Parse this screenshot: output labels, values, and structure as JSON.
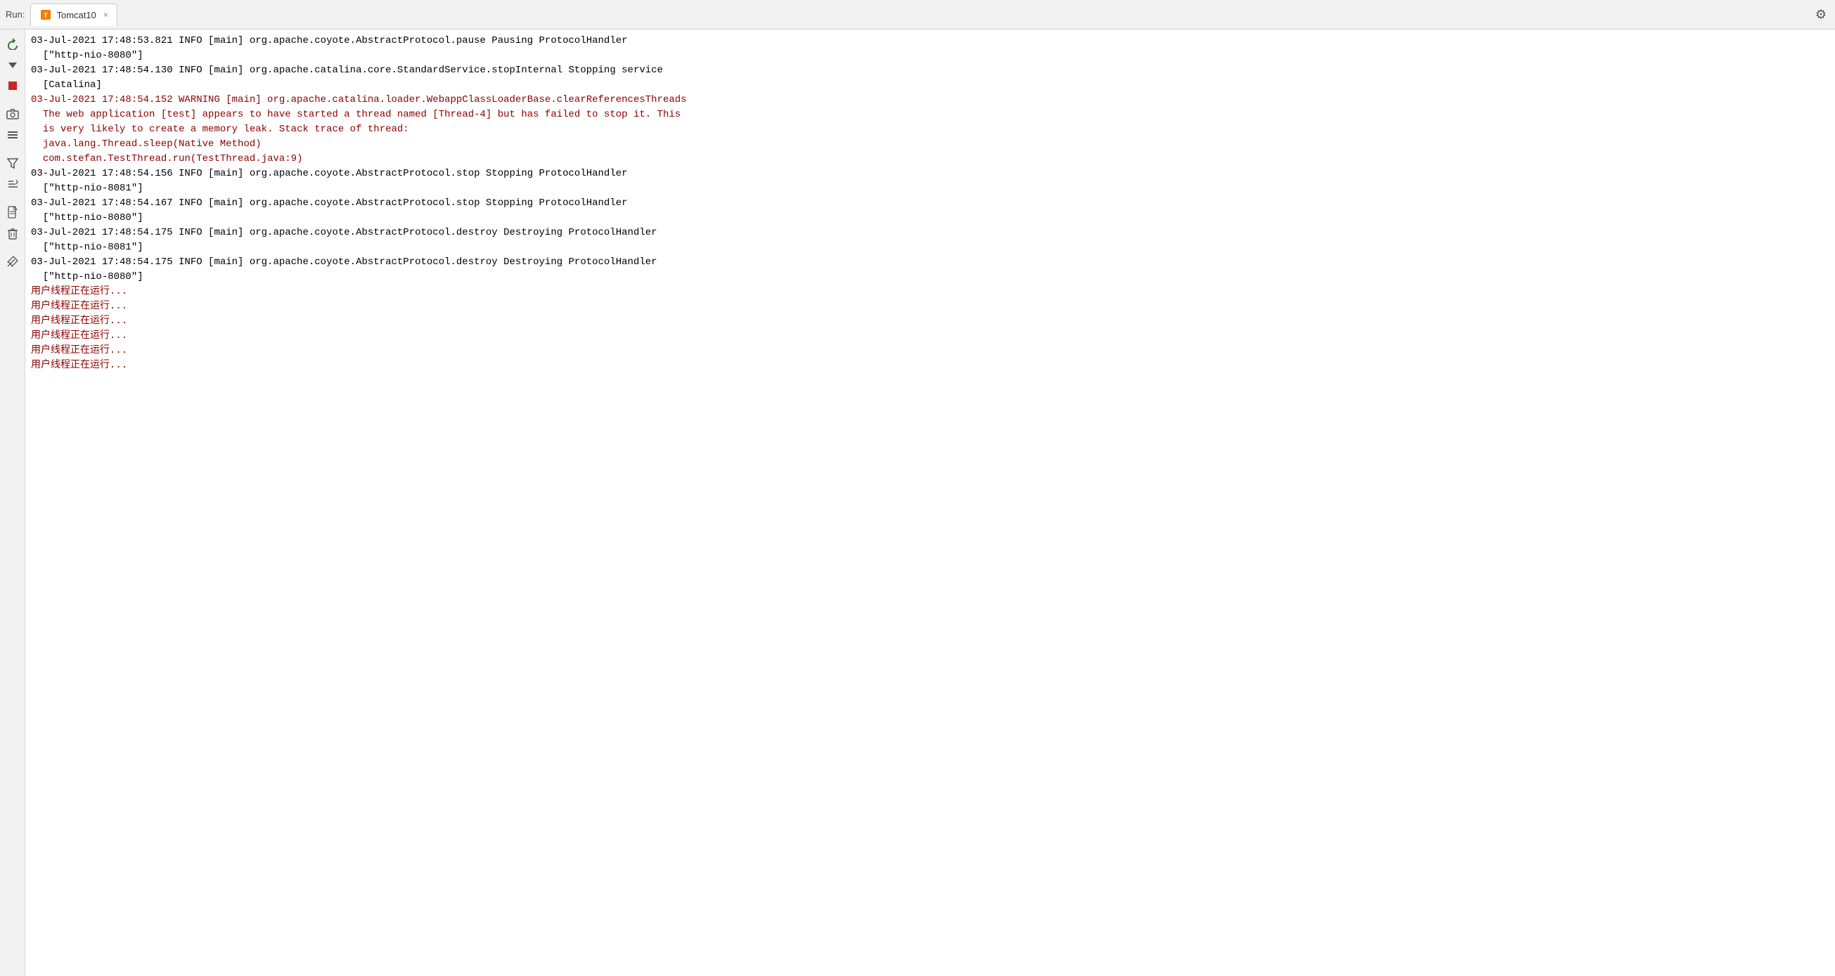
{
  "tabBar": {
    "runLabel": "Run:",
    "tab": {
      "name": "Tomcat10",
      "closeSymbol": "×"
    }
  },
  "toolbar": {
    "buttons": [
      {
        "id": "rerun",
        "symbol": "↺",
        "color": "green",
        "label": "Rerun"
      },
      {
        "id": "down",
        "symbol": "↓",
        "color": "default",
        "label": "Scroll Down"
      },
      {
        "id": "stop",
        "symbol": "■",
        "color": "red",
        "label": "Stop"
      },
      {
        "id": "separator1",
        "symbol": "",
        "color": "separator"
      },
      {
        "id": "camera",
        "symbol": "📷",
        "color": "default",
        "label": "Capture"
      },
      {
        "id": "list",
        "symbol": "≡",
        "color": "default",
        "label": "List"
      },
      {
        "id": "separator2",
        "symbol": "",
        "color": "separator"
      },
      {
        "id": "filter",
        "symbol": "⚙",
        "color": "default",
        "label": "Filter"
      },
      {
        "id": "sort",
        "symbol": "⇅",
        "color": "default",
        "label": "Sort"
      },
      {
        "id": "separator3",
        "symbol": "",
        "color": "separator"
      },
      {
        "id": "page",
        "symbol": "📄",
        "color": "default",
        "label": "Page"
      },
      {
        "id": "delete",
        "symbol": "🗑",
        "color": "default",
        "label": "Delete"
      },
      {
        "id": "separator4",
        "symbol": "",
        "color": "separator"
      },
      {
        "id": "pin",
        "symbol": "📌",
        "color": "default",
        "label": "Pin"
      }
    ]
  },
  "console": {
    "lines": [
      {
        "type": "info",
        "text": "03-Jul-2021 17:48:53.821 INFO [main] org.apache.coyote.AbstractProtocol.pause Pausing ProtocolHandler"
      },
      {
        "type": "info",
        "text": "  [\"http-nio-8080\"]"
      },
      {
        "type": "info",
        "text": "03-Jul-2021 17:48:54.130 INFO [main] org.apache.catalina.core.StandardService.stopInternal Stopping service"
      },
      {
        "type": "info",
        "text": "  [Catalina]"
      },
      {
        "type": "warning",
        "text": "03-Jul-2021 17:48:54.152 WARNING [main] org.apache.catalina.loader.WebappClassLoaderBase.clearReferencesThreads"
      },
      {
        "type": "warning",
        "text": "  The web application [test] appears to have started a thread named [Thread-4] but has failed to stop it. This"
      },
      {
        "type": "warning",
        "text": "  is very likely to create a memory leak. Stack trace of thread:"
      },
      {
        "type": "warning",
        "text": "  java.lang.Thread.sleep(Native Method)"
      },
      {
        "type": "warning",
        "text": "  com.stefan.TestThread.run(TestThread.java:9)"
      },
      {
        "type": "info",
        "text": "03-Jul-2021 17:48:54.156 INFO [main] org.apache.coyote.AbstractProtocol.stop Stopping ProtocolHandler"
      },
      {
        "type": "info",
        "text": "  [\"http-nio-8081\"]"
      },
      {
        "type": "info",
        "text": "03-Jul-2021 17:48:54.167 INFO [main] org.apache.coyote.AbstractProtocol.stop Stopping ProtocolHandler"
      },
      {
        "type": "info",
        "text": "  [\"http-nio-8080\"]"
      },
      {
        "type": "info",
        "text": "03-Jul-2021 17:48:54.175 INFO [main] org.apache.coyote.AbstractProtocol.destroy Destroying ProtocolHandler"
      },
      {
        "type": "info",
        "text": "  [\"http-nio-8081\"]"
      },
      {
        "type": "info",
        "text": "03-Jul-2021 17:48:54.175 INFO [main] org.apache.coyote.AbstractProtocol.destroy Destroying ProtocolHandler"
      },
      {
        "type": "info",
        "text": "  [\"http-nio-8080\"]"
      },
      {
        "type": "chinese",
        "text": "用户线程正在运行..."
      },
      {
        "type": "chinese",
        "text": "用户线程正在运行..."
      },
      {
        "type": "chinese",
        "text": "用户线程正在运行..."
      },
      {
        "type": "chinese",
        "text": "用户线程正在运行..."
      },
      {
        "type": "chinese",
        "text": "用户线程正在运行..."
      },
      {
        "type": "chinese",
        "text": "用户线程正在运行..."
      }
    ]
  }
}
